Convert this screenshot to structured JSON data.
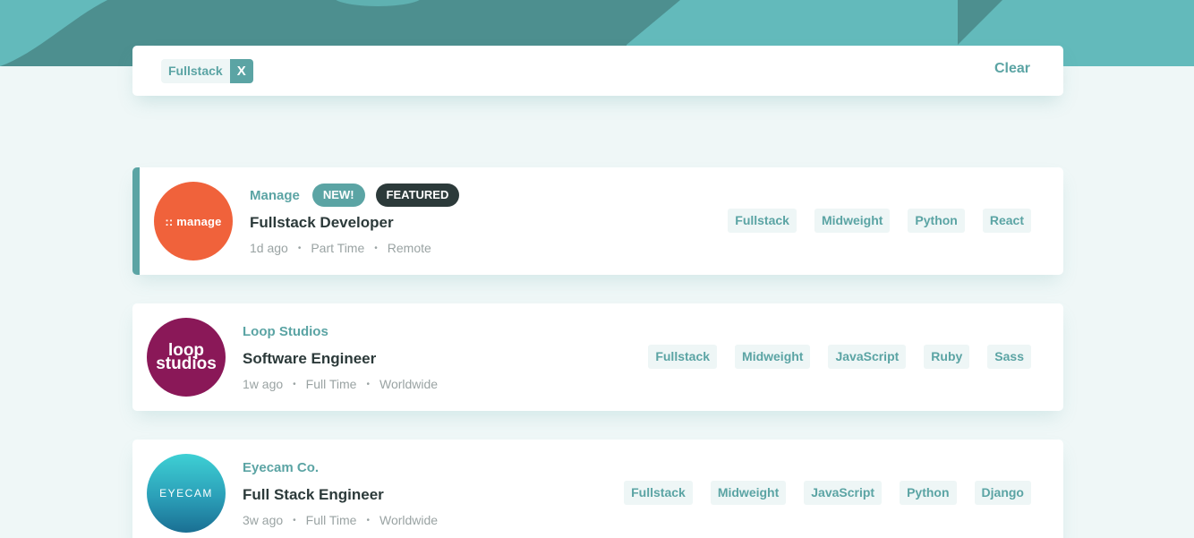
{
  "filter": {
    "chips": [
      {
        "label": "Fullstack",
        "remove": "X"
      }
    ],
    "clear": "Clear"
  },
  "jobs": [
    {
      "company": "Manage",
      "new_badge": "NEW!",
      "featured_badge": "FEATURED",
      "position": "Fullstack Developer",
      "posted": "1d ago",
      "contract": "Part Time",
      "location": "Remote",
      "tags": [
        "Fullstack",
        "Midweight",
        "Python",
        "React"
      ],
      "logo_text": ":: manage",
      "logo_color": "#f0623b"
    },
    {
      "company": "Loop Studios",
      "position": "Software Engineer",
      "posted": "1w ago",
      "contract": "Full Time",
      "location": "Worldwide",
      "tags": [
        "Fullstack",
        "Midweight",
        "JavaScript",
        "Ruby",
        "Sass"
      ],
      "logo_text_1": "loop",
      "logo_text_2": "studios",
      "logo_color": "#8a1858"
    },
    {
      "company": "Eyecam Co.",
      "position": "Full Stack Engineer",
      "posted": "3w ago",
      "contract": "Full Time",
      "location": "Worldwide",
      "tags": [
        "Fullstack",
        "Midweight",
        "JavaScript",
        "Python",
        "Django"
      ],
      "logo_text": "EYECAM",
      "logo_color": "#2fb2c1"
    }
  ],
  "meta_separator": "•"
}
